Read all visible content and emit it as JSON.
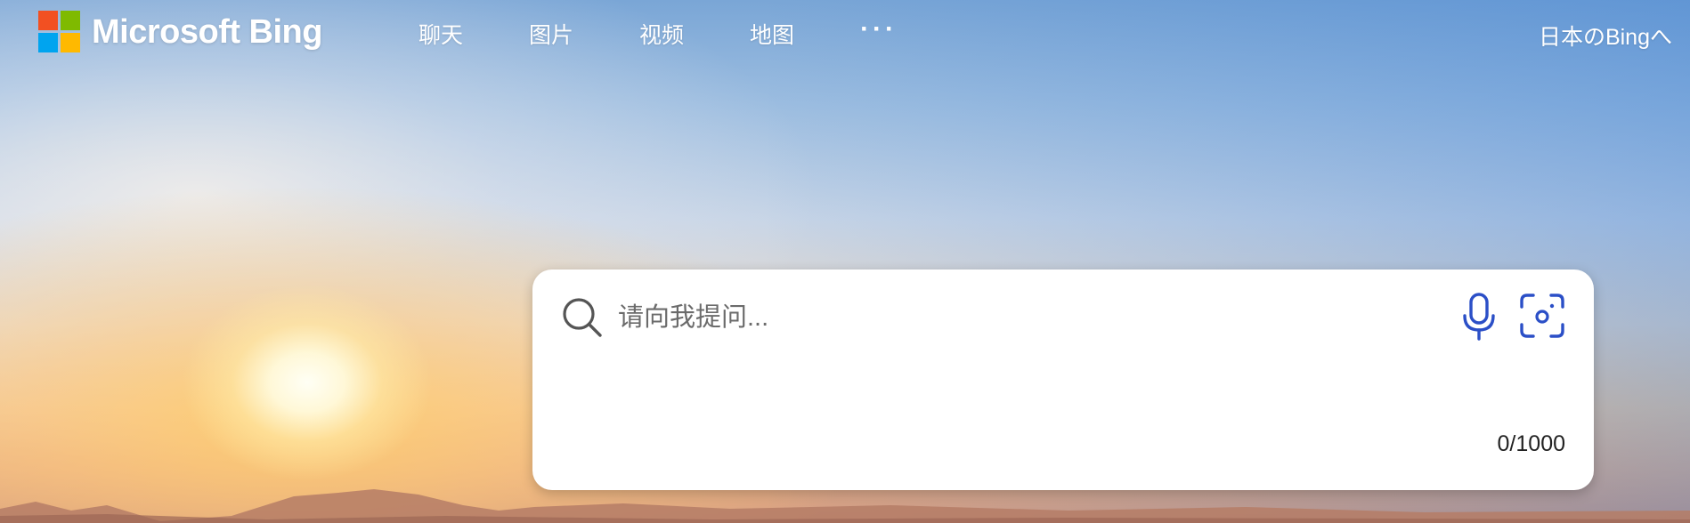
{
  "header": {
    "brand": "Microsoft Bing",
    "logo_colors": [
      "#f25022",
      "#7fba00",
      "#00a4ef",
      "#ffb900"
    ],
    "nav": [
      {
        "label": "聊天"
      },
      {
        "label": "图片"
      },
      {
        "label": "视频"
      },
      {
        "label": "地图"
      }
    ],
    "more_label": "···",
    "region_link": "日本のBingへ"
  },
  "search": {
    "placeholder": "请向我提问...",
    "value": "",
    "char_count": "0/1000",
    "icons": [
      "search-icon",
      "microphone-icon",
      "visual-search-icon"
    ],
    "accent_color": "#2b4fc7"
  }
}
